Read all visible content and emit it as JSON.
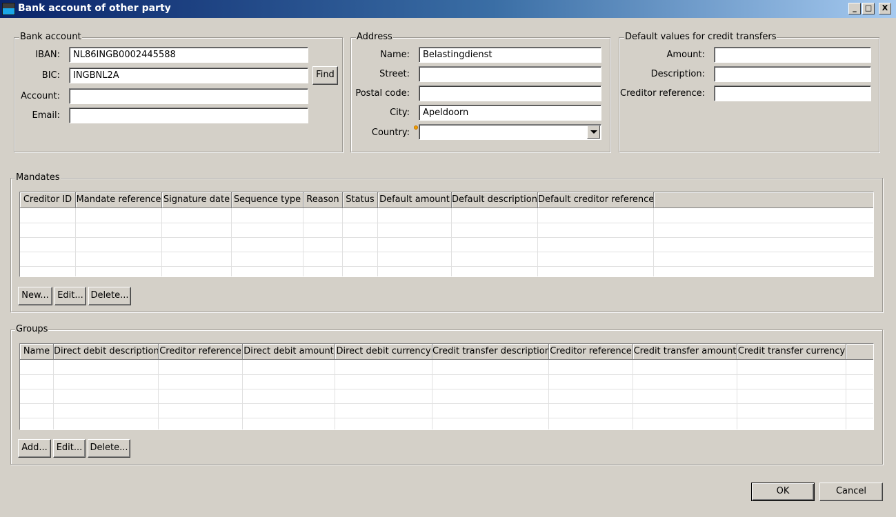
{
  "window": {
    "title": "Bank account of other party",
    "controls": [
      "_",
      "□",
      "X"
    ]
  },
  "bank_account": {
    "legend": "Bank account",
    "iban_label": "IBAN:",
    "iban_value": "NL86INGB0002445588",
    "bic_label": "BIC:",
    "bic_value": "INGBNL2A",
    "find_label": "Find",
    "account_label": "Account:",
    "account_value": "",
    "email_label": "Email:",
    "email_value": ""
  },
  "address": {
    "legend": "Address",
    "name_label": "Name:",
    "name_value": "Belastingdienst",
    "street_label": "Street:",
    "street_value": "",
    "postal_label": "Postal code:",
    "postal_value": "",
    "city_label": "City:",
    "city_value": "Apeldoorn",
    "country_label": "Country:",
    "country_value": ""
  },
  "defaults": {
    "legend": "Default values for credit transfers",
    "amount_label": "Amount:",
    "amount_value": "",
    "description_label": "Description:",
    "description_value": "",
    "creditor_label": "Creditor reference:",
    "creditor_value": ""
  },
  "mandates": {
    "legend": "Mandates",
    "columns": [
      "Creditor ID",
      "Mandate reference",
      "Signature date",
      "Sequence type",
      "Reason",
      "Status",
      "Default amount",
      "Default description",
      "Default creditor reference"
    ],
    "buttons": {
      "new": "New...",
      "edit": "Edit...",
      "delete": "Delete..."
    }
  },
  "groups": {
    "legend": "Groups",
    "columns": [
      "Name",
      "Direct debit description",
      "Creditor reference",
      "Direct debit amount",
      "Direct debit currency",
      "Credit transfer description",
      "Creditor reference",
      "Credit transfer amount",
      "Credit transfer currency"
    ],
    "buttons": {
      "add": "Add...",
      "edit": "Edit...",
      "delete": "Delete..."
    }
  },
  "footer": {
    "ok": "OK",
    "cancel": "Cancel"
  }
}
